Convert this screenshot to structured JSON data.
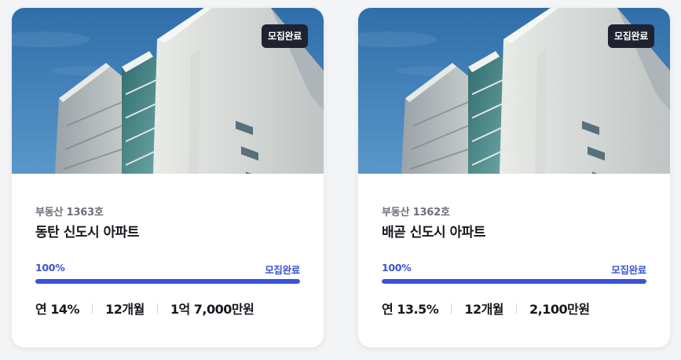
{
  "cards": [
    {
      "badge": "모집완료",
      "code": "부동산 1363호",
      "title": "동탄 신도시 아파트",
      "percent_label": "100%",
      "progress_fraction": 1.0,
      "status": "모집완료",
      "rate": "연 14%",
      "term": "12개월",
      "amount": "1억 7,000만원"
    },
    {
      "badge": "모집완료",
      "code": "부동산 1362호",
      "title": "배곧 신도시 아파트",
      "percent_label": "100%",
      "progress_fraction": 1.0,
      "status": "모집완료",
      "rate": "연 13.5%",
      "term": "12개월",
      "amount": "2,100만원"
    }
  ],
  "colors": {
    "accent": "#3853d6",
    "badge_bg": "#1f2231",
    "sky": "#3f7fb6"
  },
  "icons": {
    "photo": "apartment-building-photo"
  }
}
